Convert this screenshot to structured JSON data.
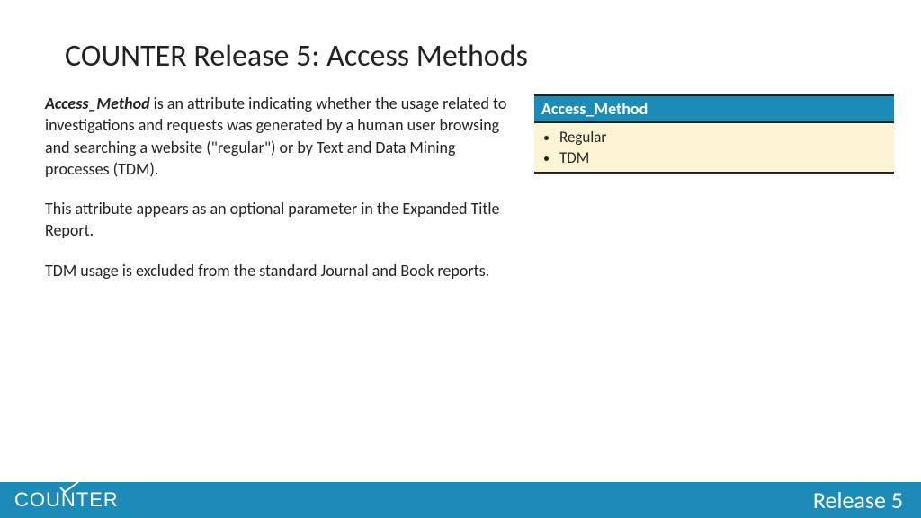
{
  "title": "COUNTER Release 5: Access Methods",
  "body": {
    "p1_strong": "Access_Method",
    "p1_rest": " is an  attribute indicating whether the usage related to investigations and requests was generated by a human user browsing and searching a website (\"regular\") or by Text and Data Mining processes (TDM).",
    "p2": "This attribute appears as an optional parameter in the Expanded Title Report.",
    "p3": "TDM usage is excluded from the standard Journal and Book reports."
  },
  "table": {
    "header": "Access_Method",
    "items": [
      "Regular",
      "TDM"
    ]
  },
  "footer": {
    "logo_pre": "COU",
    "logo_n": "N",
    "logo_post": "TER",
    "release": "Release 5"
  }
}
